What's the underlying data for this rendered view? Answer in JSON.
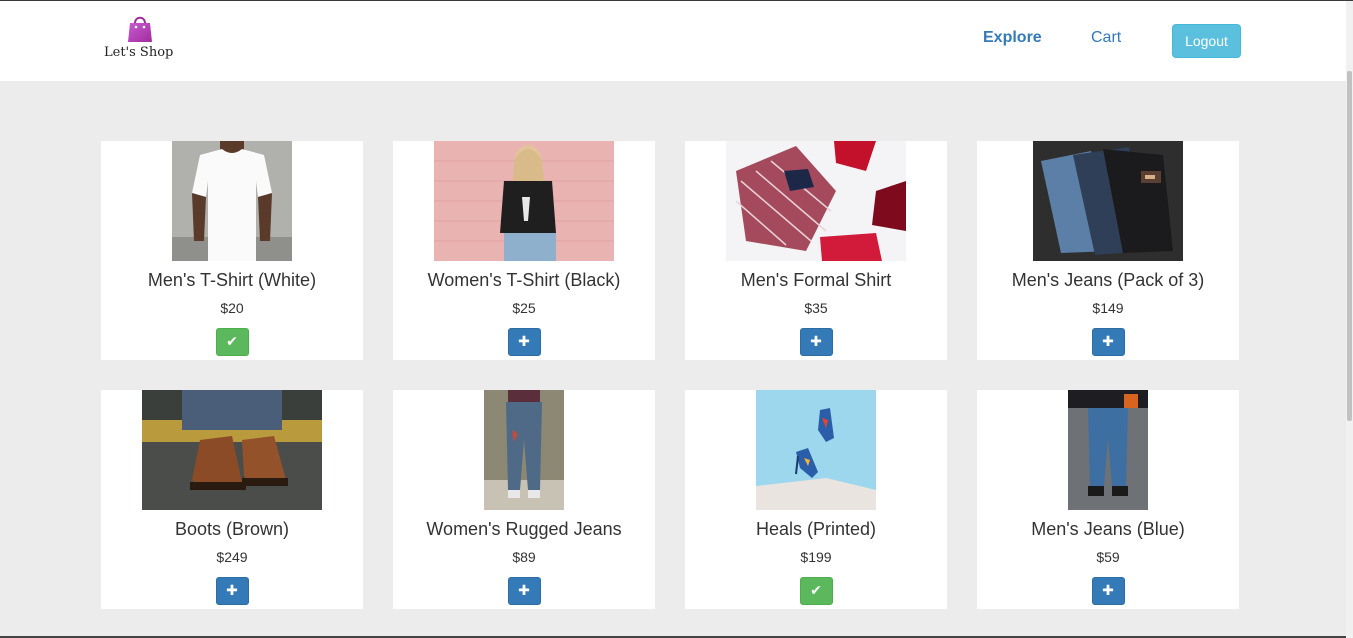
{
  "brand": {
    "name": "Let's Shop"
  },
  "nav": {
    "explore": "Explore",
    "cart": "Cart",
    "logout": "Logout"
  },
  "colors": {
    "primary": "#337ab7",
    "success": "#5cb85c",
    "info": "#5bc0de",
    "background": "#ececec"
  },
  "products": [
    {
      "name": "Men's T-Shirt (White)",
      "price": "$20",
      "in_cart": true,
      "icon": "check-icon"
    },
    {
      "name": "Women's T-Shirt (Black)",
      "price": "$25",
      "in_cart": false,
      "icon": "plus-icon"
    },
    {
      "name": "Men's Formal Shirt",
      "price": "$35",
      "in_cart": false,
      "icon": "plus-icon"
    },
    {
      "name": "Men's Jeans (Pack of 3)",
      "price": "$149",
      "in_cart": false,
      "icon": "plus-icon"
    },
    {
      "name": "Boots (Brown)",
      "price": "$249",
      "in_cart": false,
      "icon": "plus-icon"
    },
    {
      "name": "Women's Rugged Jeans",
      "price": "$89",
      "in_cart": false,
      "icon": "plus-icon"
    },
    {
      "name": "Heals (Printed)",
      "price": "$199",
      "in_cart": true,
      "icon": "check-icon"
    },
    {
      "name": "Men's Jeans (Blue)",
      "price": "$59",
      "in_cart": false,
      "icon": "plus-icon"
    }
  ]
}
